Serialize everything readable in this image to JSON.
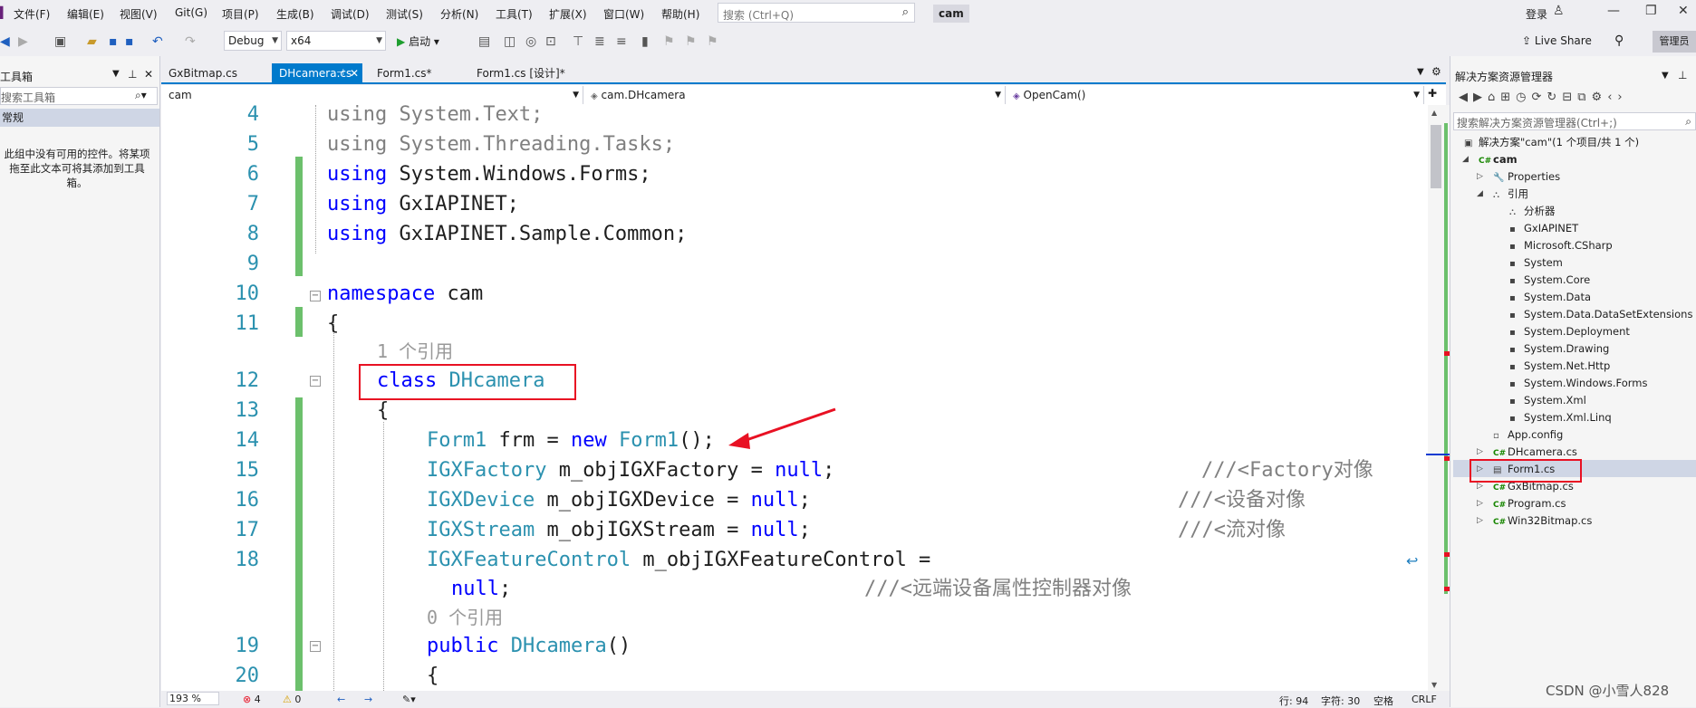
{
  "menu": [
    "文件(F)",
    "编辑(E)",
    "视图(V)",
    "Git(G)",
    "项目(P)",
    "生成(B)",
    "调试(D)",
    "测试(S)",
    "分析(N)",
    "工具(T)",
    "扩展(X)",
    "窗口(W)",
    "帮助(H)"
  ],
  "search_placeholder": "搜索 (Ctrl+Q)",
  "project_name": "cam",
  "login": "登录",
  "toolbar": {
    "config": "Debug",
    "platform": "x64",
    "start": "启动",
    "live_share": "Live Share",
    "admin": "管理员"
  },
  "toolbox": {
    "title": "工具箱",
    "search_placeholder": "搜索工具箱",
    "category": "常规",
    "empty_message": "此组中没有可用的控件。将某项拖至此文本可将其添加到工具箱。"
  },
  "tabs": [
    {
      "label": "GxBitmap.cs",
      "active": false
    },
    {
      "label": "DHcamera.cs",
      "active": true
    },
    {
      "label": "Form1.cs*",
      "active": false
    },
    {
      "label": "Form1.cs [设计]*",
      "active": false
    }
  ],
  "nav": {
    "project": "cam",
    "class": "cam.DHcamera",
    "member": "OpenCam()"
  },
  "code": {
    "l4": {
      "num": "4",
      "kw": "using",
      "rest": " System.Text;"
    },
    "l5": {
      "num": "5",
      "kw": "using",
      "rest": " System.Threading.Tasks;"
    },
    "l6": {
      "num": "6",
      "kw": "using",
      "rest": " System.Windows.Forms;"
    },
    "l7": {
      "num": "7",
      "kw": "using",
      "rest": " GxIAPINET;"
    },
    "l8": {
      "num": "8",
      "kw": "using",
      "rest": " GxIAPINET.Sample.Common;"
    },
    "l9": {
      "num": "9"
    },
    "l10": {
      "num": "10",
      "kw": "namespace",
      "rest": " cam"
    },
    "l11": {
      "num": "11",
      "text": "{"
    },
    "ref1": "1 个引用",
    "l12": {
      "num": "12",
      "kw": "class",
      "name": " DHcamera"
    },
    "l13": {
      "num": "13",
      "text": "{"
    },
    "l14": {
      "num": "14",
      "t1": "Form1",
      "v": " frm = ",
      "kw": "new",
      "t2": " Form1",
      "end": "();"
    },
    "l15": {
      "num": "15",
      "t": "IGXFactory",
      "v": " m_objIGXFactory = ",
      "kw": "null",
      "end": ";",
      "comment": "///<Factory对像"
    },
    "l16": {
      "num": "16",
      "t": "IGXDevice",
      "v": " m_objIGXDevice = ",
      "kw": "null",
      "end": ";",
      "comment": "///<设备对像"
    },
    "l17": {
      "num": "17",
      "t": "IGXStream",
      "v": " m_objIGXStream = ",
      "kw": "null",
      "end": ";",
      "comment": "///<流对像"
    },
    "l18": {
      "num": "18",
      "t": "IGXFeatureControl",
      "v": " m_objIGXFeatureControl ="
    },
    "l18b": {
      "kw": "null",
      "end": ";",
      "comment": "///<远端设备属性控制器对像"
    },
    "ref0": "0 个引用",
    "l19": {
      "num": "19",
      "kw": "public",
      "name": " DHcamera",
      "end": "()"
    },
    "l20": {
      "num": "20",
      "text": "{"
    }
  },
  "status": {
    "zoom": "193 %",
    "errors": "4",
    "warnings": "0",
    "line": "行: 94",
    "col": "字符: 30",
    "space": "空格",
    "eol": "CRLF"
  },
  "solution_explorer": {
    "title": "解决方案资源管理器",
    "search_placeholder": "搜索解决方案资源管理器(Ctrl+;)",
    "solution": "解决方案\"cam\"(1 个项目/共 1 个)",
    "project": "cam",
    "properties": "Properties",
    "references": "引用",
    "ref_items": [
      "分析器",
      "GxIAPINET",
      "Microsoft.CSharp",
      "System",
      "System.Core",
      "System.Data",
      "System.Data.DataSetExtensions",
      "System.Deployment",
      "System.Drawing",
      "System.Net.Http",
      "System.Windows.Forms",
      "System.Xml",
      "System.Xml.Linq"
    ],
    "files": [
      "App.config",
      "DHcamera.cs",
      "Form1.cs",
      "GxBitmap.cs",
      "Program.cs",
      "Win32Bitmap.cs"
    ]
  },
  "watermark": "CSDN @小雪人828"
}
